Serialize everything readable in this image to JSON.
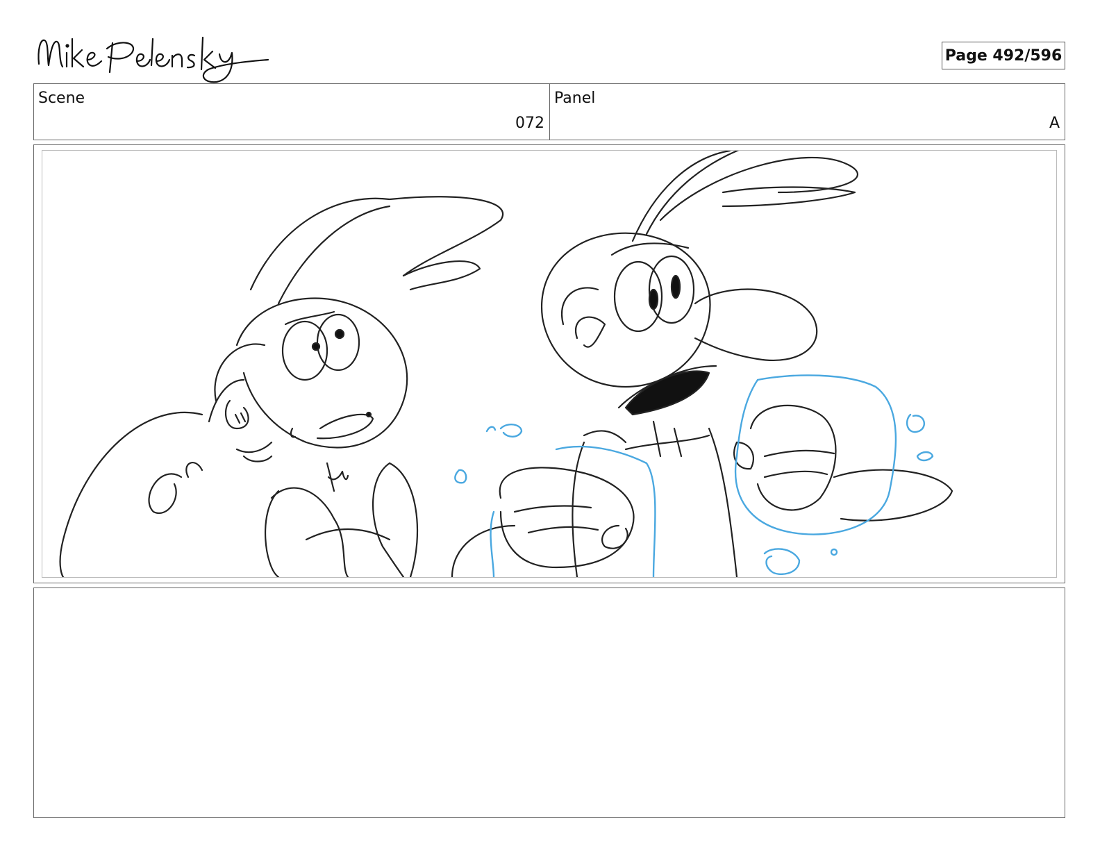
{
  "header": {
    "signature_text": "Mike Pelensky",
    "page_label": "Page 492/596"
  },
  "info": {
    "scene_label": "Scene",
    "scene_value": "072",
    "panel_label": "Panel",
    "panel_value": "A"
  },
  "colors": {
    "pencil": "#222222",
    "blue_fx": "#4aa8e0",
    "border": "#666666"
  },
  "notes": {
    "text": ""
  }
}
